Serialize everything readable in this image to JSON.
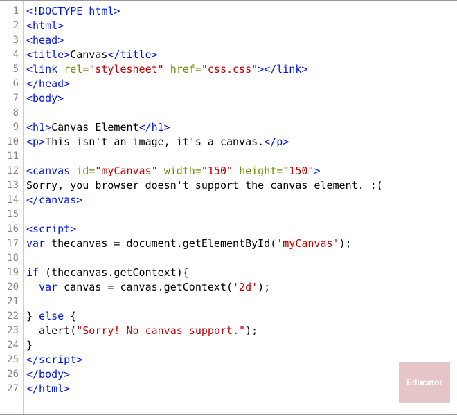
{
  "watermark": "Educator",
  "lines": [
    {
      "n": 1,
      "tokens": [
        {
          "c": "t-tag",
          "t": "<!DOCTYPE html>"
        }
      ]
    },
    {
      "n": 2,
      "tokens": [
        {
          "c": "t-tag",
          "t": "<html>"
        }
      ]
    },
    {
      "n": 3,
      "tokens": [
        {
          "c": "t-tag",
          "t": "<head>"
        }
      ]
    },
    {
      "n": 4,
      "tokens": [
        {
          "c": "t-tag",
          "t": "<title>"
        },
        {
          "c": "t-txt",
          "t": "Canvas"
        },
        {
          "c": "t-tag",
          "t": "</title>"
        }
      ]
    },
    {
      "n": 5,
      "tokens": [
        {
          "c": "t-tag",
          "t": "<link"
        },
        {
          "c": "t-txt",
          "t": " "
        },
        {
          "c": "t-attr",
          "t": "rel="
        },
        {
          "c": "t-str",
          "t": "\"stylesheet\""
        },
        {
          "c": "t-txt",
          "t": " "
        },
        {
          "c": "t-attr",
          "t": "href="
        },
        {
          "c": "t-str",
          "t": "\"css.css\""
        },
        {
          "c": "t-tag",
          "t": ">"
        },
        {
          "c": "t-tag",
          "t": "</link>"
        }
      ]
    },
    {
      "n": 6,
      "tokens": [
        {
          "c": "t-tag",
          "t": "</head>"
        }
      ]
    },
    {
      "n": 7,
      "tokens": [
        {
          "c": "t-tag",
          "t": "<body>"
        }
      ]
    },
    {
      "n": 8,
      "tokens": [
        {
          "c": "t-txt",
          "t": ""
        }
      ]
    },
    {
      "n": 9,
      "tokens": [
        {
          "c": "t-tag",
          "t": "<h1>"
        },
        {
          "c": "t-txt",
          "t": "Canvas Element"
        },
        {
          "c": "t-tag",
          "t": "</h1>"
        }
      ]
    },
    {
      "n": 10,
      "tokens": [
        {
          "c": "t-tag",
          "t": "<p>"
        },
        {
          "c": "t-txt",
          "t": "This isn't an image, it's a canvas."
        },
        {
          "c": "t-tag",
          "t": "</p>"
        }
      ]
    },
    {
      "n": 11,
      "tokens": [
        {
          "c": "t-txt",
          "t": ""
        }
      ]
    },
    {
      "n": 12,
      "tokens": [
        {
          "c": "t-tag",
          "t": "<canvas"
        },
        {
          "c": "t-txt",
          "t": " "
        },
        {
          "c": "t-attr",
          "t": "id="
        },
        {
          "c": "t-str",
          "t": "\"myCanvas\""
        },
        {
          "c": "t-txt",
          "t": " "
        },
        {
          "c": "t-attr",
          "t": "width="
        },
        {
          "c": "t-str",
          "t": "\"150\""
        },
        {
          "c": "t-txt",
          "t": " "
        },
        {
          "c": "t-attr",
          "t": "height="
        },
        {
          "c": "t-str",
          "t": "\"150\""
        },
        {
          "c": "t-tag",
          "t": ">"
        }
      ]
    },
    {
      "n": 13,
      "tokens": [
        {
          "c": "t-txt",
          "t": "Sorry, you browser doesn't support the canvas element. :("
        }
      ]
    },
    {
      "n": 14,
      "tokens": [
        {
          "c": "t-tag",
          "t": "</canvas>"
        }
      ]
    },
    {
      "n": 15,
      "tokens": [
        {
          "c": "t-txt",
          "t": ""
        }
      ]
    },
    {
      "n": 16,
      "tokens": [
        {
          "c": "t-tag",
          "t": "<script>"
        }
      ]
    },
    {
      "n": 17,
      "tokens": [
        {
          "c": "t-kw",
          "t": "var"
        },
        {
          "c": "t-txt",
          "t": " thecanvas = document.getElementById("
        },
        {
          "c": "t-str",
          "t": "'myCanvas'"
        },
        {
          "c": "t-txt",
          "t": ");"
        }
      ]
    },
    {
      "n": 18,
      "tokens": [
        {
          "c": "t-txt",
          "t": ""
        }
      ]
    },
    {
      "n": 19,
      "tokens": [
        {
          "c": "t-kw",
          "t": "if"
        },
        {
          "c": "t-txt",
          "t": " (thecanvas.getContext){"
        }
      ]
    },
    {
      "n": 20,
      "tokens": [
        {
          "c": "t-txt",
          "t": "  "
        },
        {
          "c": "t-kw",
          "t": "var"
        },
        {
          "c": "t-txt",
          "t": " canvas = canvas.getContext("
        },
        {
          "c": "t-str",
          "t": "'2d'"
        },
        {
          "c": "t-txt",
          "t": ");"
        }
      ]
    },
    {
      "n": 21,
      "tokens": [
        {
          "c": "t-txt",
          "t": ""
        }
      ]
    },
    {
      "n": 22,
      "tokens": [
        {
          "c": "t-txt",
          "t": "} "
        },
        {
          "c": "t-kw",
          "t": "else"
        },
        {
          "c": "t-txt",
          "t": " {"
        }
      ]
    },
    {
      "n": 23,
      "tokens": [
        {
          "c": "t-txt",
          "t": "  alert("
        },
        {
          "c": "t-str",
          "t": "\"Sorry! No canvas support.\""
        },
        {
          "c": "t-txt",
          "t": ");"
        }
      ]
    },
    {
      "n": 24,
      "tokens": [
        {
          "c": "t-txt",
          "t": "}"
        }
      ]
    },
    {
      "n": 25,
      "tokens": [
        {
          "c": "t-tag",
          "t": "</script>"
        }
      ]
    },
    {
      "n": 26,
      "tokens": [
        {
          "c": "t-tag",
          "t": "</body>"
        }
      ]
    },
    {
      "n": 27,
      "tokens": [
        {
          "c": "t-tag",
          "t": "</html>"
        }
      ]
    }
  ]
}
